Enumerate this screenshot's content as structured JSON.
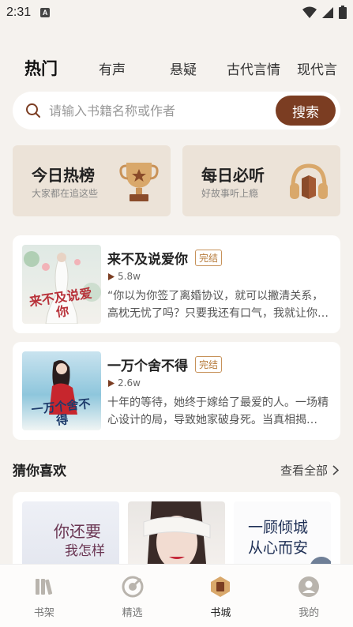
{
  "status": {
    "time": "2:31",
    "notif_letter": "A"
  },
  "tabs": [
    {
      "label": "热门",
      "active": true
    },
    {
      "label": "有声"
    },
    {
      "label": "悬疑"
    },
    {
      "label": "古代言情"
    },
    {
      "label": "现代言"
    }
  ],
  "search": {
    "placeholder": "请输入书籍名称或作者",
    "button": "搜索"
  },
  "promos": [
    {
      "title": "今日热榜",
      "subtitle": "大家都在追这些",
      "icon": "trophy-icon"
    },
    {
      "title": "每日必听",
      "subtitle": "好故事听上瘾",
      "icon": "headphones-icon"
    }
  ],
  "books": [
    {
      "title": "来不及说爱你",
      "badge": "完结",
      "plays": "5.8w",
      "desc": "“你以为你签了离婚协议，就可以撇清关系，高枕无忧了吗？只要我还有口气，我就让你…",
      "cover_text": "来不及说爱你"
    },
    {
      "title": "一万个舍不得",
      "badge": "完结",
      "plays": "2.6w",
      "desc": "十年的等待，她终于嫁给了最爱的人。一场精心设计的局，导致她家破身死。当真相揭…",
      "cover_text": "一万个舍不得"
    }
  ],
  "recommend": {
    "title": "猜你喜欢",
    "see_all": "查看全部",
    "covers": [
      {
        "text_top": "你还要",
        "text_bottom": "我怎样"
      },
      {
        "text_top": ""
      },
      {
        "text_top": "一顾倾城",
        "text_bottom": "从心而安"
      }
    ]
  },
  "nav": [
    {
      "label": "书架",
      "icon": "bookshelf-icon"
    },
    {
      "label": "精选",
      "icon": "compass-icon"
    },
    {
      "label": "书城",
      "icon": "bookstore-icon",
      "active": true
    },
    {
      "label": "我的",
      "icon": "profile-icon"
    }
  ],
  "colors": {
    "accent": "#7b3d22",
    "badge": "#b67a3a",
    "promo_bg": "#ece3d8"
  }
}
